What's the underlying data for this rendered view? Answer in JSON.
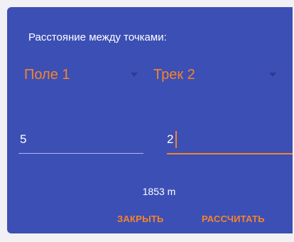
{
  "dialog": {
    "title": "Расстояние между точками:",
    "from_spinner": {
      "selected": "Поле 1"
    },
    "to_spinner": {
      "selected": "Трек 2"
    },
    "from_input": {
      "value": "5"
    },
    "to_input": {
      "value": "2"
    },
    "result": "1853 m",
    "close_label": "ЗАКРЫТЬ",
    "calculate_label": "РАССЧИТАТЬ"
  },
  "colors": {
    "dialog_background": "#3c4fb5",
    "accent": "#f3842c",
    "text": "#ffffff"
  }
}
